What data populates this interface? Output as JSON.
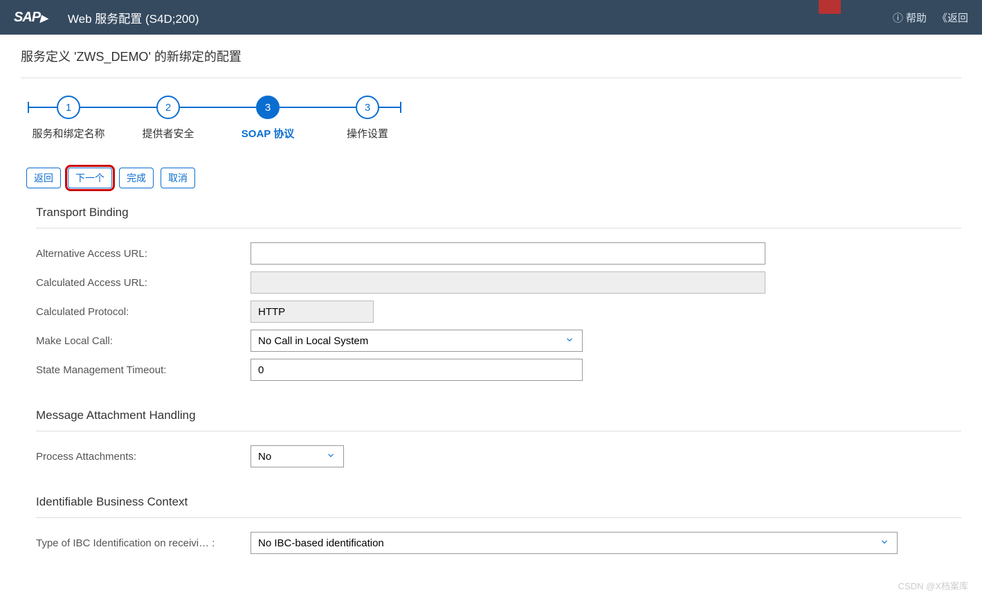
{
  "header": {
    "logo": "SAP",
    "title": "Web 服务配置 (S4D;200)",
    "help": "帮助",
    "back": "返回"
  },
  "subtitle": "服务定义 'ZWS_DEMO' 的新绑定的配置",
  "wizard": {
    "steps": [
      {
        "num": "1",
        "label": "服务和绑定名称"
      },
      {
        "num": "2",
        "label": "提供者安全"
      },
      {
        "num": "3",
        "label": "SOAP 协议"
      },
      {
        "num": "3",
        "label": "操作设置"
      }
    ],
    "active_index": 2
  },
  "buttons": {
    "back": "返回",
    "next": "下一个",
    "finish": "完成",
    "cancel": "取消"
  },
  "sections": {
    "transport": {
      "title": "Transport Binding",
      "alt_url_label": "Alternative Access URL:",
      "alt_url_value": "",
      "calc_url_label": "Calculated Access URL:",
      "calc_url_value": "",
      "calc_proto_label": "Calculated Protocol:",
      "calc_proto_value": "HTTP",
      "local_call_label": "Make Local Call:",
      "local_call_value": "No Call in Local System",
      "state_timeout_label": "State Management Timeout:",
      "state_timeout_value": "0"
    },
    "attachment": {
      "title": "Message Attachment Handling",
      "process_label": "Process Attachments:",
      "process_value": "No"
    },
    "ibc": {
      "title": "Identifiable Business Context",
      "type_label": "Type of IBC Identification on receivi…  :",
      "type_value": "No IBC-based identification"
    }
  },
  "watermark": "CSDN @X档案库"
}
